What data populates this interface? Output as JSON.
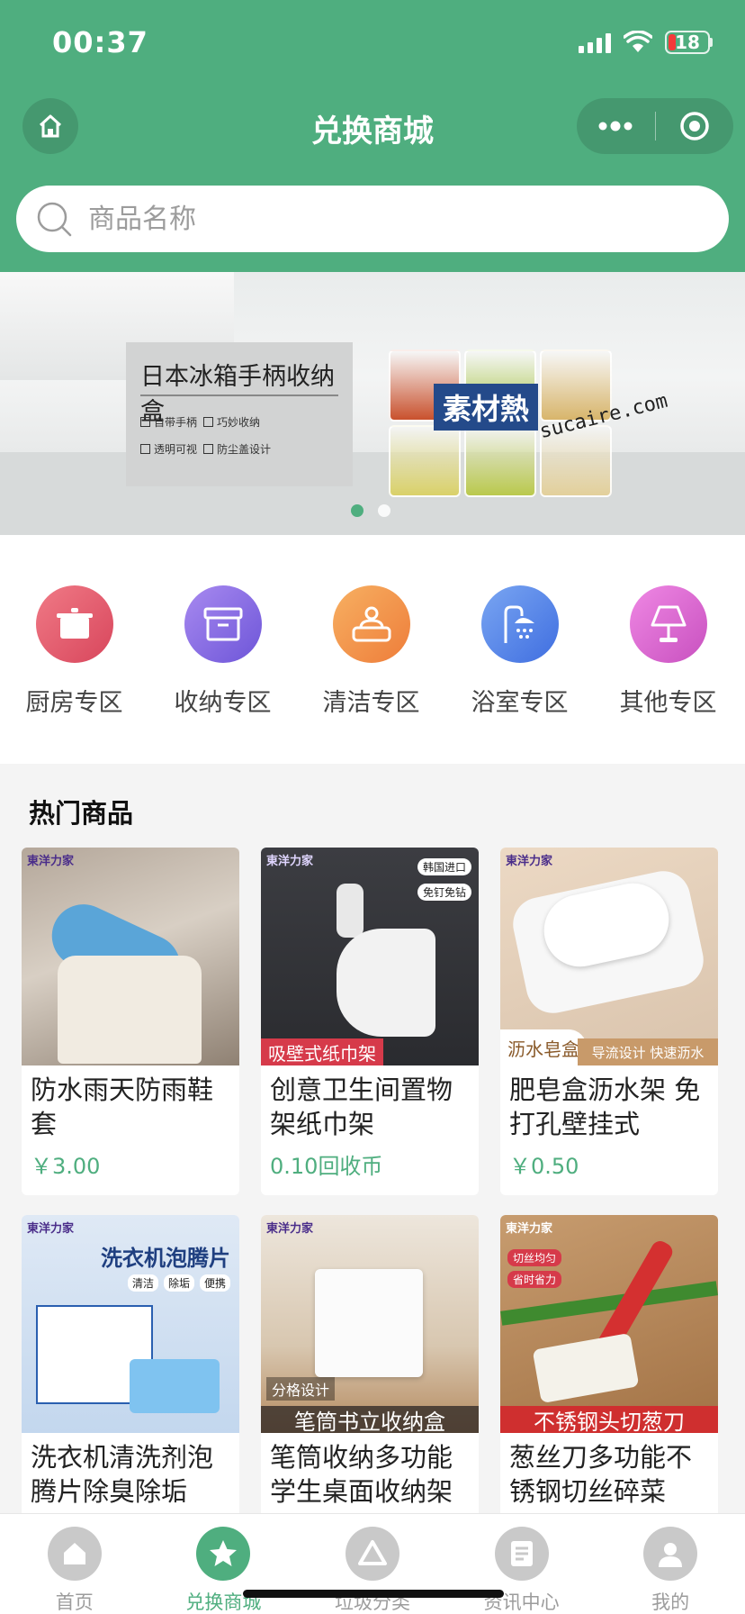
{
  "status_bar": {
    "time": "00:37",
    "battery": "18"
  },
  "nav": {
    "title": "兑换商城",
    "home_icon": "home-icon",
    "more_icon": "more-dots-icon",
    "target_icon": "target-icon"
  },
  "search": {
    "placeholder": "商品名称"
  },
  "banner": {
    "title": "日本冰箱手柄收纳盒",
    "features": [
      "自带手柄",
      "巧妙收纳",
      "透明可视",
      "防尘盖设计"
    ],
    "watermark_cn": "素材熱",
    "watermark_url": "sucaire.com",
    "slides": 2,
    "active_slide": 1
  },
  "categories": [
    {
      "label": "厨房专区",
      "icon": "pot-icon",
      "color": "#e2566a"
    },
    {
      "label": "收纳专区",
      "icon": "storage-box-icon",
      "color": "#8f6ae0"
    },
    {
      "label": "清洁专区",
      "icon": "cleaning-icon",
      "color": "#f0954a"
    },
    {
      "label": "浴室专区",
      "icon": "shower-icon",
      "color": "#5a8be8"
    },
    {
      "label": "其他专区",
      "icon": "lamp-icon",
      "color": "#d86bd0"
    }
  ],
  "hot": {
    "title": "热门商品",
    "products": [
      {
        "name": "防水雨天防雨鞋套",
        "price": "￥3.00",
        "brand": "東洋力家",
        "tag": ""
      },
      {
        "name": "创意卫生间置物架纸巾架",
        "price": "0.10回收币",
        "brand": "東洋力家",
        "tag": "吸壁式纸巾架",
        "side_tags": [
          "韩国进口",
          "免钉免钻"
        ]
      },
      {
        "name": "肥皂盒沥水架 免打孔壁挂式",
        "price": "￥0.50",
        "brand": "東洋力家",
        "tag": "沥水皂盒",
        "tag_extra": "导流设计  快速沥水"
      },
      {
        "name": "洗衣机清洗剂泡腾片除臭除垢",
        "price": "",
        "brand": "東洋力家",
        "tag": "洗衣机泡腾片",
        "sub_tags": [
          "清洁",
          "除垢",
          "便携"
        ]
      },
      {
        "name": "笔筒收纳多功能学生桌面收纳架",
        "price": "",
        "brand": "東洋力家",
        "tag": "笔筒书立收纳盒",
        "tag_small": "分格设计"
      },
      {
        "name": "葱丝刀多功能不锈钢切丝碎菜",
        "price": "",
        "brand": "東洋力家",
        "tag": "不锈钢头切葱刀",
        "side_tags": [
          "切丝均匀",
          "省时省力"
        ]
      }
    ]
  },
  "tabbar": [
    {
      "label": "首页",
      "icon": "home-icon",
      "active": false
    },
    {
      "label": "兑换商城",
      "icon": "star-icon",
      "active": true
    },
    {
      "label": "垃圾分类",
      "icon": "recycle-icon",
      "active": false
    },
    {
      "label": "资讯中心",
      "icon": "news-icon",
      "active": false
    },
    {
      "label": "我的",
      "icon": "user-icon",
      "active": false
    }
  ]
}
